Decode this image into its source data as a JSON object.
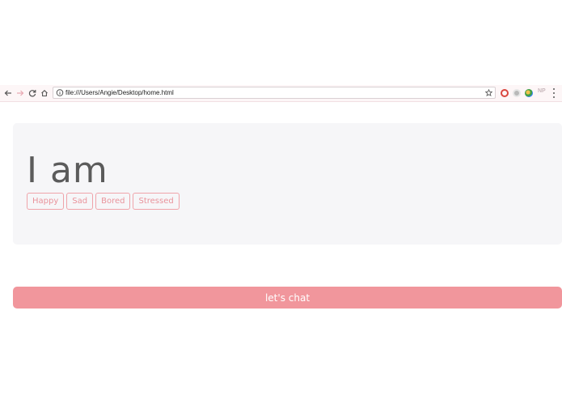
{
  "browser": {
    "url": "file:///Users/Angie/Desktop/home.html",
    "extension_label": "NP",
    "icons": {
      "back": "arrow-left-icon",
      "forward": "arrow-right-icon",
      "reload": "reload-icon",
      "home": "home-icon",
      "info": "info-icon",
      "bookmark": "star-icon",
      "menu": "kebab-menu-icon"
    }
  },
  "main": {
    "headline": "I am",
    "moods": [
      "Happy",
      "Sad",
      "Bored",
      "Stressed"
    ]
  },
  "cta": {
    "label": "let's chat"
  },
  "colors": {
    "accent": "#f1969c",
    "chip_border": "#efa4aa",
    "chip_text": "#e9939b",
    "card_bg": "#f6f6f8",
    "headline": "#5b5b5b"
  }
}
